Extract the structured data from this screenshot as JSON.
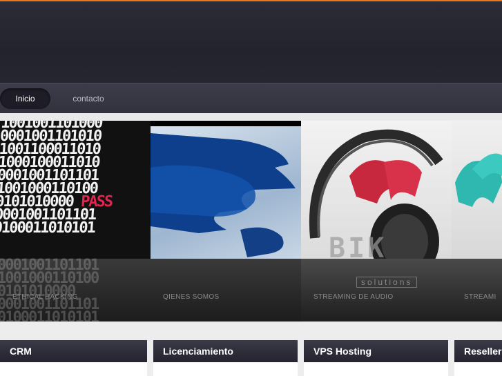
{
  "nav": {
    "items": [
      {
        "label": "Inicio",
        "active": true
      },
      {
        "label": "contacto",
        "active": false
      }
    ]
  },
  "slider": {
    "panels": [
      {
        "caption": "ETHICAL HACKING",
        "image": "binary-code-password"
      },
      {
        "caption": "QIENES SOMOS",
        "image": "blue-puzzle-pieces"
      },
      {
        "caption": "STREAMING DE AUDIO",
        "image": "headphones-logo"
      },
      {
        "caption": "STREAMI",
        "image": "logo-cropped"
      }
    ],
    "binary_text": "1001001101000\n0001001101010\n1001100011010\n1000100011010\n0001001101101\n1001000110100\n0101010000 PASS\n0001001101101\n0100011010101",
    "logo_text": "BIK",
    "logo_sub": "solutions"
  },
  "boxes": [
    {
      "title": "CRM"
    },
    {
      "title": "Licenciamiento"
    },
    {
      "title": "VPS Hosting"
    },
    {
      "title": "Reseller"
    }
  ],
  "colors": {
    "accent": "#e8791e",
    "header": "#262631",
    "nav_active": "#1d1c27",
    "password_red": "#e0264f"
  }
}
